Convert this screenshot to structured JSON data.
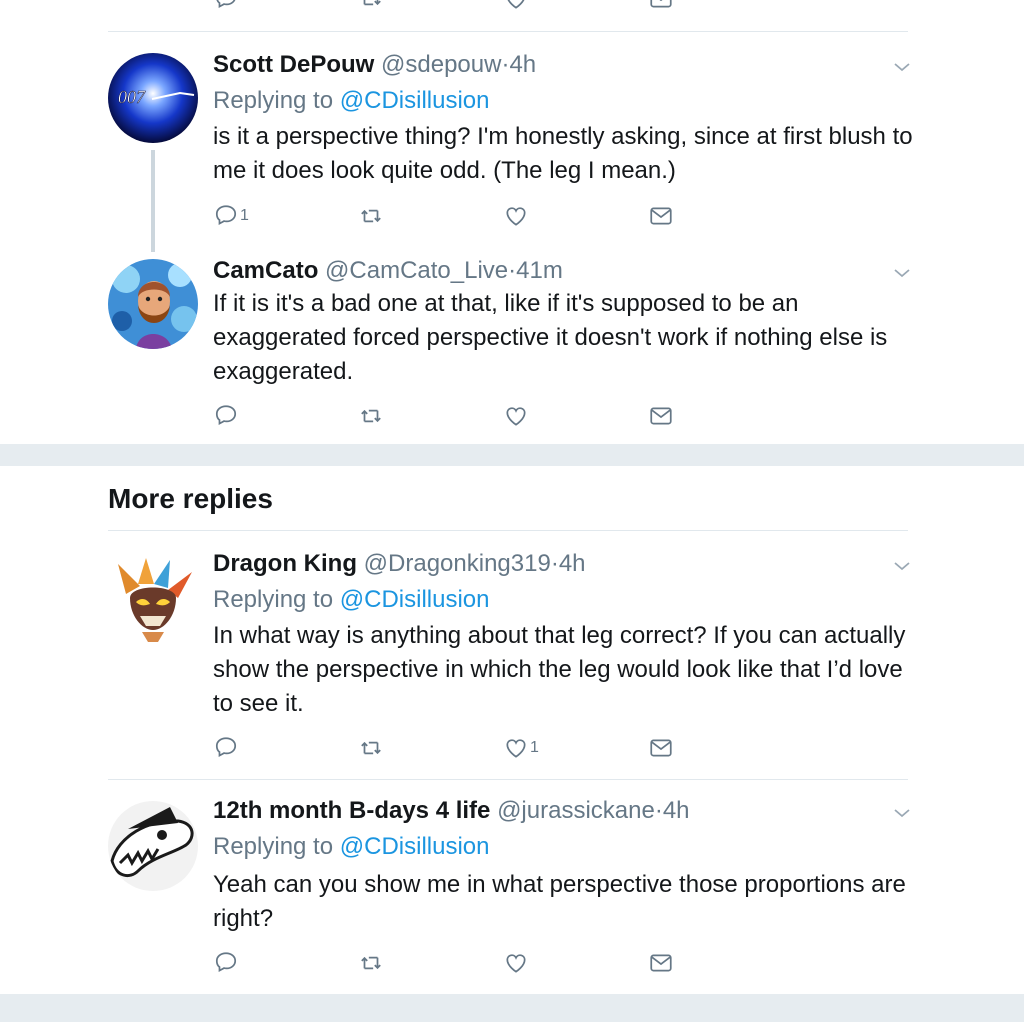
{
  "section": {
    "more_replies": "More replies"
  },
  "tweets": [
    {
      "name": "Scott DePouw",
      "handle": "@sdepouw",
      "time": "4h",
      "replying_prefix": "Replying to",
      "replying_to": "@CDisillusion",
      "text": "is it a perspective thing? I'm honestly asking, since at first blush to me it does look quite odd. (The leg I mean.)",
      "reply_count": "1",
      "like_count": "",
      "avatar": "007-logo"
    },
    {
      "name": "CamCato",
      "handle": "@CamCato_Live",
      "time": "41m",
      "text": "If it is it's a bad one at that, like if it's supposed to be an exaggerated forced perspective it doesn't work if nothing else is exaggerated.",
      "reply_count": "",
      "like_count": "",
      "avatar": "bearded-man"
    },
    {
      "name": "Dragon King",
      "handle": "@Dragonking319",
      "time": "4h",
      "replying_prefix": "Replying to",
      "replying_to": "@CDisillusion",
      "text": "In what way is anything about that leg correct? If you can actually show the perspective in which the leg would look like that I’d love to see it.",
      "reply_count": "",
      "like_count": "1",
      "avatar": "dragon"
    },
    {
      "name": "12th month B-days 4 life",
      "handle": "@jurassickane",
      "time": "4h",
      "replying_prefix": "Replying to",
      "replying_to": "@CDisillusion",
      "text": "Yeah can you show me in what perspective those proportions are right?",
      "reply_count": "",
      "like_count": "",
      "avatar": "dinosaur-skull"
    }
  ],
  "separator": "·",
  "icons": [
    "reply-icon",
    "retweet-icon",
    "like-icon",
    "direct-message-icon",
    "chevron-down-icon"
  ],
  "colors": {
    "link": "#1b95e0",
    "muted": "#657786",
    "text": "#14171a",
    "divider": "#e1e8ed",
    "section_gap": "#e6ecf0"
  }
}
